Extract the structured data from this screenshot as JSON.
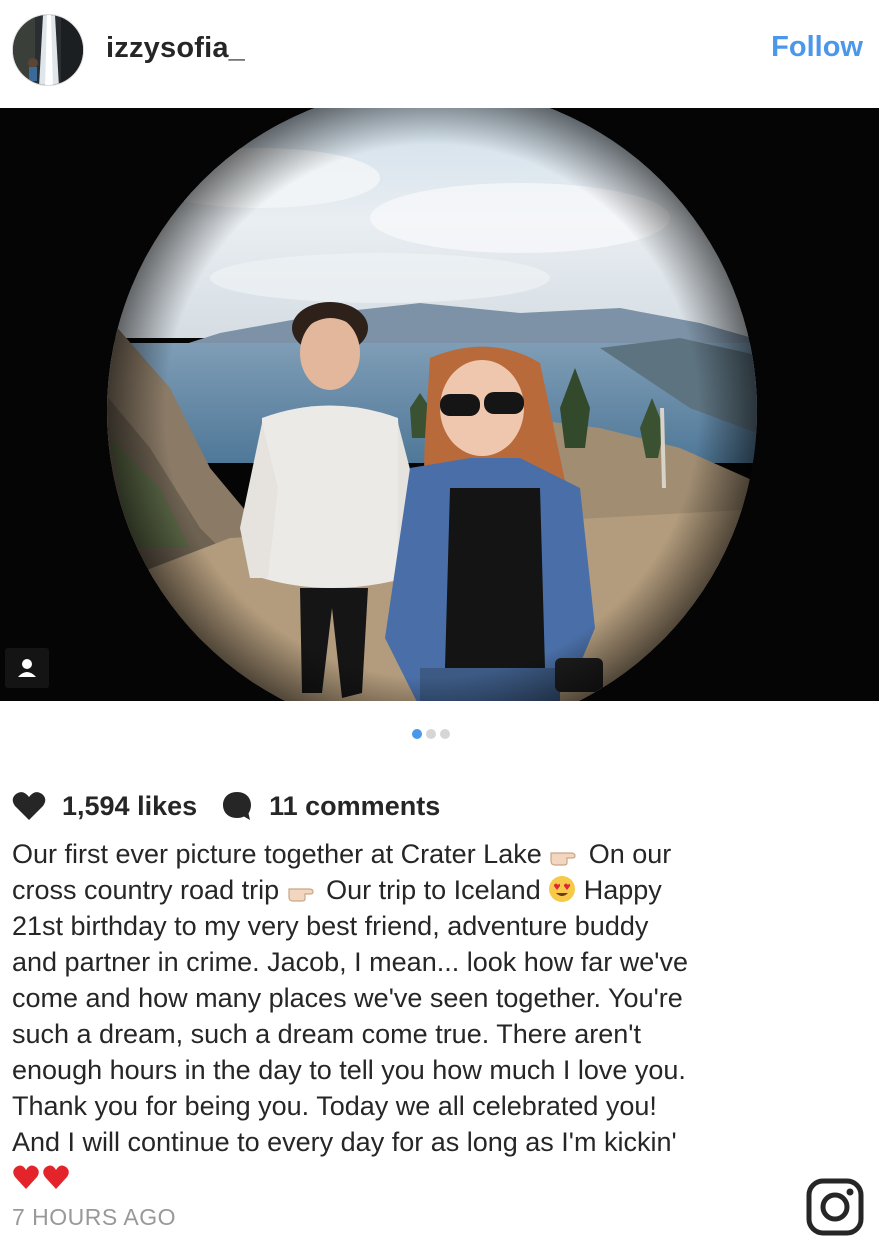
{
  "header": {
    "username": "izzysofia_",
    "follow_label": "Follow"
  },
  "photo": {
    "description_icon": "tagged-people-icon",
    "carousel_dots": 3,
    "carousel_active_index": 0
  },
  "stats": {
    "likes": "1,594 likes",
    "comments": "11 comments"
  },
  "caption": {
    "lines": [
      "Our first ever picture together at Crater Lake ",
      " On our",
      "cross country road trip ",
      " Our trip to Iceland ",
      " Happy",
      "21st birthday to my very best friend, adventure buddy",
      "and partner in crime. Jacob, I mean... look how far we've",
      "come and how many places we've seen together. You're",
      "such a dream, such a dream come true. There aren't",
      "enough hours in the day to tell you how much I love you.",
      "Thank you for being you. Today we all celebrated you!",
      "And I will continue to every day for as long as I'm kickin'"
    ]
  },
  "timestamp": "7 HOURS AGO",
  "colors": {
    "accent": "#4b97ea",
    "text": "#262626",
    "muted": "#999999"
  }
}
